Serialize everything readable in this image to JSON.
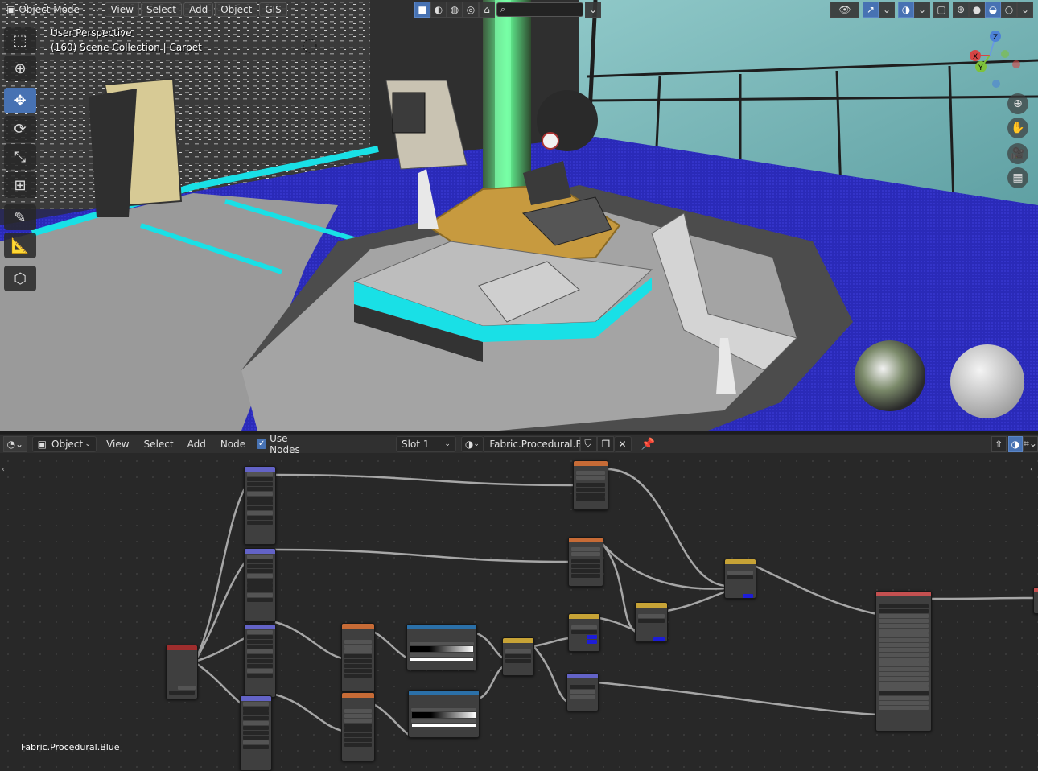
{
  "viewport": {
    "mode_label": "Object Mode",
    "menus": [
      "View",
      "Select",
      "Add",
      "Object",
      "GIS"
    ],
    "perspective_label": "User Perspective",
    "collection_label": "(160) Scene Collection | Carpet",
    "axes": {
      "x": "X",
      "y": "Y",
      "z": "Z"
    }
  },
  "node_editor": {
    "editor_type": "Object",
    "menus": [
      "View",
      "Select",
      "Add",
      "Node"
    ],
    "use_nodes_label": "Use Nodes",
    "use_nodes_checked": true,
    "slot_label": "Slot 1",
    "material_name": "Fabric.Procedural.Bl...",
    "material_full_name": "Fabric.Procedural.Blue"
  },
  "colors": {
    "accent": "#4772b3",
    "node_input_header": "#9e2d2d",
    "node_texture_header": "#c76b36",
    "node_color_header": "#2b70a8",
    "node_vector_header": "#6363c7",
    "node_shader_header": "#c45050",
    "link": "#bdbdbd",
    "carpet": "#2525b0",
    "glow": "#19e0e6"
  }
}
